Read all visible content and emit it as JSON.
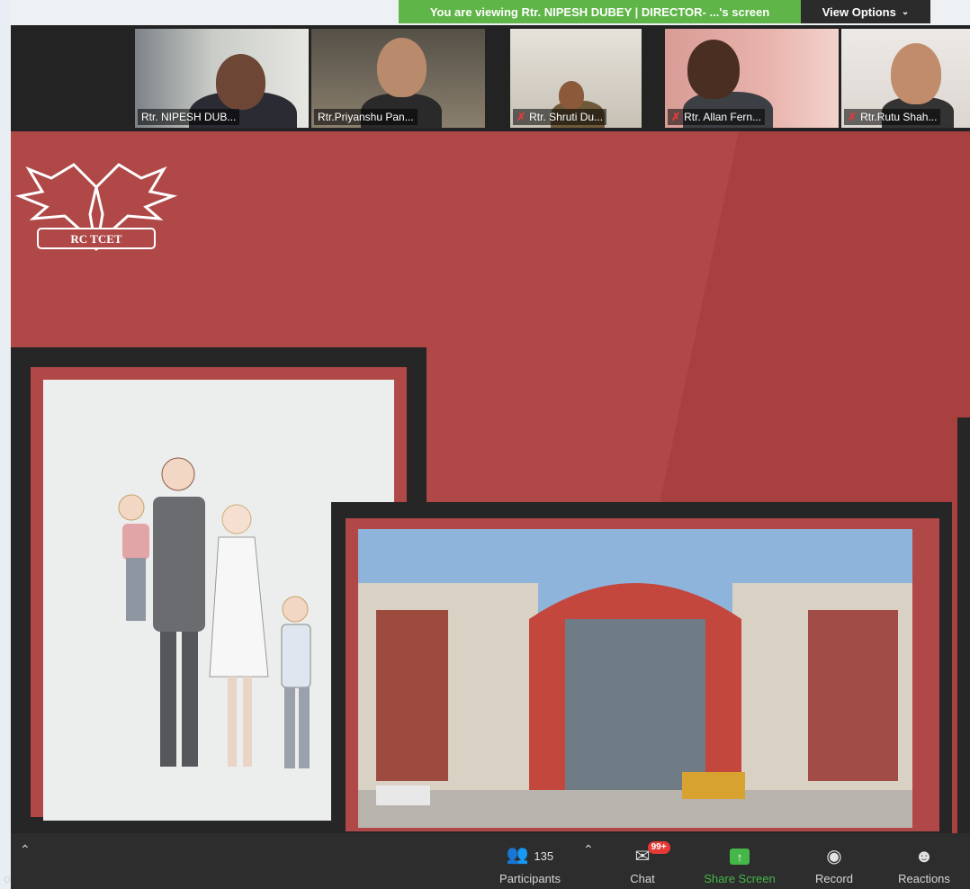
{
  "banner": {
    "text": "You are viewing Rtr. NIPESH DUBEY | DIRECTOR- ...'s screen",
    "view_options": "View Options"
  },
  "participants": [
    {
      "name": "Rtr. NIPESH DUB...",
      "muted": false
    },
    {
      "name": "Rtr.Priyanshu Pan...",
      "muted": false
    },
    {
      "name": "Rtr. Shruti Du...",
      "muted": true
    },
    {
      "name": "Rtr. Allan Fern...",
      "muted": true
    },
    {
      "name": "Rtr.Rutu Shah...",
      "muted": true
    }
  ],
  "slide": {
    "logo_text": "RC TCET"
  },
  "toolbar": {
    "participants_label": "Participants",
    "participants_count": "135",
    "chat_label": "Chat",
    "chat_badge": "99+",
    "share_label": "Share Screen",
    "record_label": "Record",
    "reactions_label": "Reactions",
    "left_edge_text": "o"
  },
  "colors": {
    "banner": "#5fb547",
    "slide_red": "#b04848",
    "toolbar": "#2d2d2d",
    "share_green": "#45b648",
    "badge_red": "#e53935"
  }
}
